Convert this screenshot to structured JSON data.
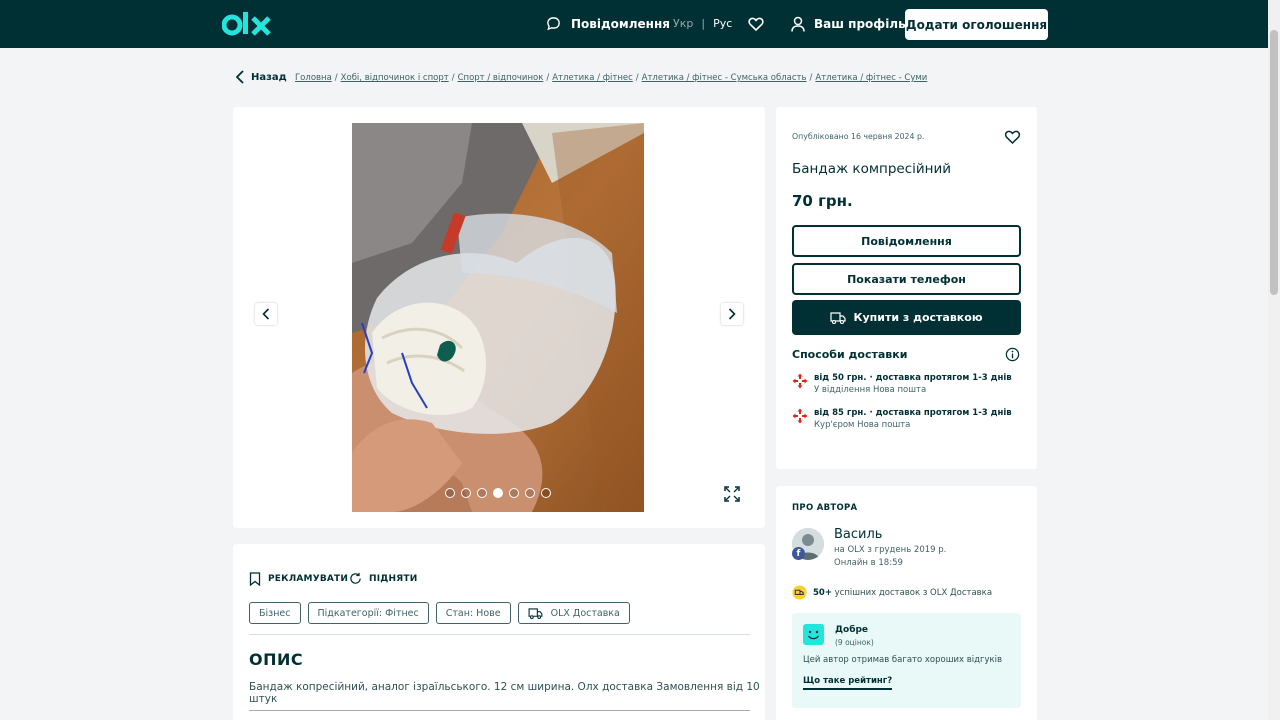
{
  "header": {
    "messages_label": "Повідомлення",
    "lang_ukr": "Укр",
    "lang_sep": "|",
    "lang_rus": "Рус",
    "profile_label": "Ваш профіль",
    "add_ad_label": "Додати оголошення"
  },
  "breadcrumbs": {
    "back_label": "Назад",
    "items": [
      "Головна",
      "Хобі, відпочинок і спорт",
      "Спорт / відпочинок",
      "Атлетика / фітнес",
      "Атлетика / фітнес - Сумська область",
      "Атлетика / фітнес - Суми"
    ],
    "separator": "/"
  },
  "gallery": {
    "photo_count": 7,
    "active_index": 3
  },
  "listing": {
    "published": "Опубліковано 16 червня 2024 р.",
    "title": "Бандаж компресійний",
    "price": "70 грн.",
    "message_button": "Повідомлення",
    "phone_button": "Показати телефон",
    "buy_button": "Купити з доставкою",
    "delivery_heading": "Способи доставки",
    "delivery_options": [
      {
        "line1": "від 50 грн. · доставка протягом 1-3 днів",
        "line2": "У відділення Нова пошта"
      },
      {
        "line1": "від 85 грн. · доставка протягом 1-3 днів",
        "line2": "Кур'єром Нова пошта"
      }
    ]
  },
  "description": {
    "promote_label": "РЕКЛАМУВАТИ",
    "raise_label": "ПІДНЯТИ",
    "tags": [
      "Бізнес",
      "Підкатегорії: Фітнес",
      "Стан: Нове",
      "OLX Доставка"
    ],
    "heading": "ОПИС",
    "text": "Бандаж копресійний, аналог ізраїльського. 12 см ширина. Олх доставка Замовлення від 10 штук"
  },
  "author": {
    "heading": "ПРО АВТОРА",
    "name": "Василь",
    "since": "на OLX з грудень 2019 р.",
    "online": "Онлайн в 18:59",
    "deliveries_count": "50+",
    "deliveries_text": " успішних доставок з OLX Доставка",
    "rating_label": "Добре",
    "rating_count": "(9 оцінок)",
    "rating_text": "Цей автор отримав багато хороших відгуків",
    "rating_link": "Що таке рейтинг?"
  },
  "colors": {
    "brand_dark": "#002f34",
    "brand_teal": "#23e5db",
    "background": "#f2f4f5",
    "nova_poshta_red": "#da291c"
  }
}
